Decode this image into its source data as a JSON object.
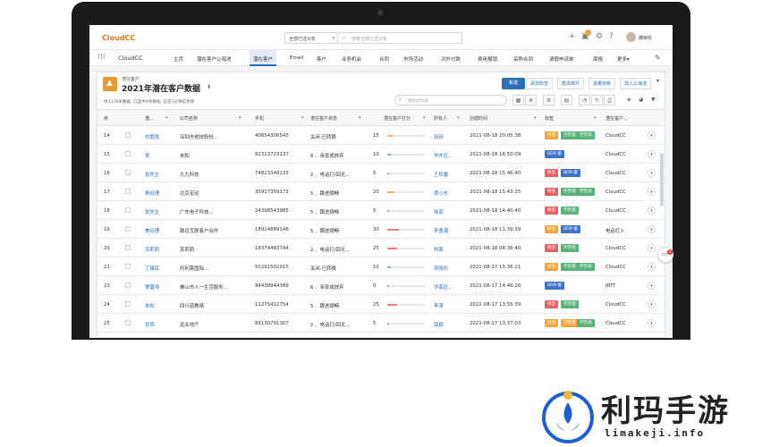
{
  "topbar": {
    "logo": "CloudCC",
    "scope": "全部已选对象",
    "search_placeholder": "搜索全部已选对象",
    "user_name": "魏钟凯"
  },
  "nav": {
    "app_name": "CloudCC",
    "items": [
      "主页",
      "潜在客户公海池",
      "潜在客户",
      "Email",
      "客户",
      "业务机会",
      "合同",
      "市场活动",
      "对外付款",
      "费用报销",
      "采购合同",
      "请假申请单",
      "周报",
      "更多▾"
    ],
    "active_index": 2
  },
  "header": {
    "breadcrumb": "潜在客户",
    "view_title": "2021年潜在客户数据",
    "summary": "共1376条数据, 已选中0条数据, 已在1分钟前更新",
    "new_button": "新建",
    "actions": [
      "添加标签",
      "群发邮件",
      "批量转移",
      "加入公海池"
    ],
    "list_search_placeholder": "搜索此列表"
  },
  "table": {
    "columns": [
      "序",
      "",
      "潜...",
      "公司名称",
      "手机",
      "潜在客户状态",
      "潜在客户打分",
      "所有人",
      "创建时间",
      "标签",
      "潜在客户..."
    ],
    "rows": [
      {
        "no": "14",
        "name": "刘震雨",
        "company": "深圳市他技股份...",
        "phone": "40654306543",
        "status": "关闭-已转换",
        "score": "15",
        "score_val": 15,
        "owner": "田田",
        "created": "2021-08-18 20:05:38",
        "tags": [
          {
            "t": "标签",
            "c": "#f2a53c"
          },
          {
            "t": "学历提",
            "c": "#57b37a"
          },
          {
            "t": "学历高",
            "c": "#57b37a"
          }
        ],
        "source": "CloudCC"
      },
      {
        "no": "15",
        "name": "吴",
        "company": "未知",
        "phone": "82313723137",
        "status": "6 、亲景成放弃",
        "score": "10",
        "score_val": 10,
        "owner": "华东区...",
        "created": "2021-08-18 16:50:09",
        "tags": [
          {
            "t": "BDR-富",
            "c": "#3f73c9"
          }
        ],
        "source": "CloudCC"
      },
      {
        "no": "16",
        "name": "张先生",
        "company": "九九科技",
        "phone": "74823348233",
        "status": "2 、电话打/回无...",
        "score": "5",
        "score_val": 5,
        "owner": "王松馨",
        "created": "2021-08-18 15:46:40",
        "tags": [
          {
            "t": "标签",
            "c": "#e66262"
          },
          {
            "t": "BDR-富",
            "c": "#3f73c9"
          }
        ],
        "source": "CloudCC"
      },
      {
        "no": "17",
        "name": "杨经理",
        "company": "北京宏动",
        "phone": "35917359173",
        "status": "5 、跟进顺畅",
        "score": "20",
        "score_val": 20,
        "owner": "黄小东",
        "created": "2021-08-18 15:43:35",
        "tags": [
          {
            "t": "标签",
            "c": "#e66262"
          },
          {
            "t": "学历提",
            "c": "#57b37a"
          },
          {
            "t": "学历高",
            "c": "#57b37a"
          }
        ],
        "source": "CloudCC"
      },
      {
        "no": "18",
        "name": "张先生",
        "company": "广东电子科技...",
        "phone": "24398543985",
        "status": "5 、跟进顺畅",
        "score": "5",
        "score_val": 5,
        "owner": "徐丽",
        "created": "2021-08-18 14:40:40",
        "tags": [
          {
            "t": "标签",
            "c": "#e66262"
          },
          {
            "t": "学历提",
            "c": "#57b37a"
          }
        ],
        "source": "CloudCC"
      },
      {
        "no": "19",
        "name": "焦经理",
        "company": "致远互联客户合作",
        "phone": "18914889148",
        "status": "5 、跟进顺畅",
        "score": "30",
        "score_val": 30,
        "owner": "李墨潮",
        "created": "2021-08-18 11:39:39",
        "tags": [
          {
            "t": "标签",
            "c": "#f2a53c"
          },
          {
            "t": "BDR-富",
            "c": "#3f73c9"
          }
        ],
        "source": "电话打入"
      },
      {
        "no": "20",
        "name": "苏莉莉",
        "company": "苏莉莉",
        "phone": "18374483744",
        "status": "2 、电话打/回无...",
        "score": "25",
        "score_val": 25,
        "owner": "刘笑",
        "created": "2021-08-18 08:36:40",
        "tags": [
          {
            "t": "标签",
            "c": "#e66262"
          },
          {
            "t": "学历提",
            "c": "#57b37a"
          }
        ],
        "source": "CloudCC"
      },
      {
        "no": "21",
        "name": "丁锋民",
        "company": "托利莱国际...",
        "phone": "50291502915",
        "status": "关闭-已转换",
        "score": "10",
        "score_val": 10,
        "owner": "吴晓杉",
        "created": "2021-08-17 15:36:21",
        "tags": [
          {
            "t": "标签",
            "c": "#f2a53c"
          },
          {
            "t": "学历提",
            "c": "#57b37a"
          },
          {
            "t": "学历高",
            "c": "#57b37a"
          }
        ],
        "source": "CloudCC"
      },
      {
        "no": "23",
        "name": "曹雷涛",
        "company": "佛山市人一生活服务...",
        "phone": "94438944389",
        "status": "6 、亲景成放弃",
        "score": "0",
        "score_val": 0,
        "owner": "华南区...",
        "created": "2021-08-17 14:46:26",
        "tags": [
          {
            "t": "BDR-富",
            "c": "#3f73c9"
          }
        ],
        "source": "JRTT"
      },
      {
        "no": "24",
        "name": "未知",
        "company": "四川道教晴",
        "phone": "11275412754",
        "status": "5 、跟进顺畅",
        "score": "25",
        "score_val": 25,
        "owner": "李涛",
        "created": "2021-08-17 13:55:39",
        "tags": [
          {
            "t": "标签",
            "c": "#e66262"
          },
          {
            "t": "学历提",
            "c": "#57b37a"
          }
        ],
        "source": "CloudCC"
      },
      {
        "no": "25",
        "name": "张西",
        "company": "远业地产",
        "phone": "89130791307",
        "status": "2 、电话打/回无...",
        "score": "5",
        "score_val": 5,
        "owner": "邵颖",
        "created": "2021-08-17 13:37:03",
        "tags": [
          {
            "t": "标签",
            "c": "#f2a53c"
          },
          {
            "t": "学历提",
            "c": "#f2a53c"
          },
          {
            "t": "学历高",
            "c": "#57b37a"
          }
        ],
        "source": "CloudCC"
      }
    ]
  },
  "floating": {
    "badge": "1"
  },
  "watermark": {
    "text": "利玛手游",
    "url": "limakeji.info"
  }
}
